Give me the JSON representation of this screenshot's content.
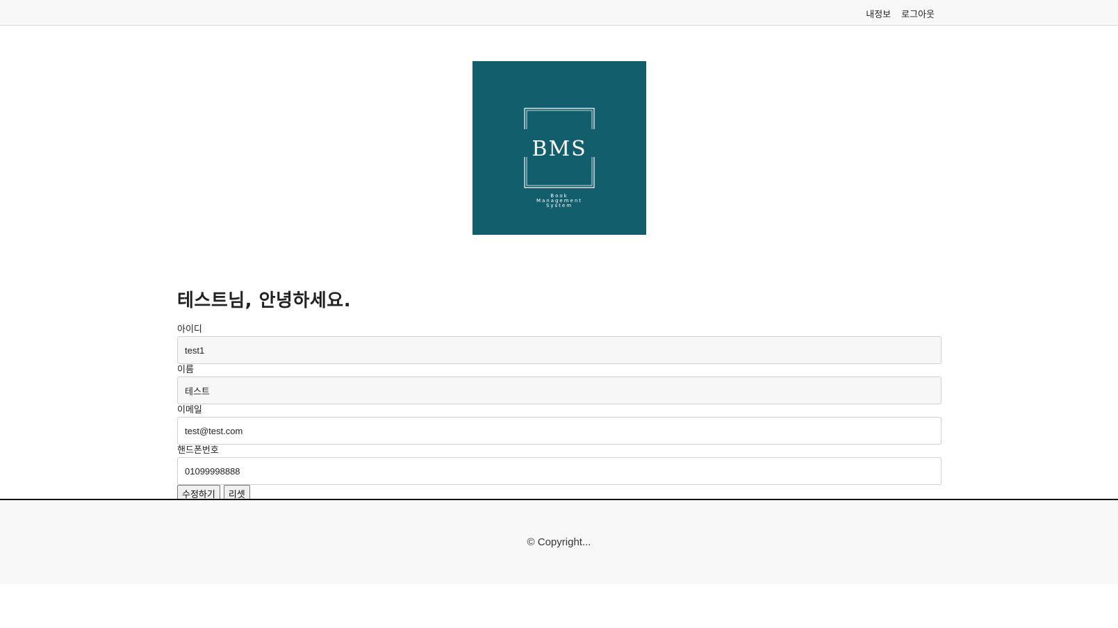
{
  "header": {
    "nav": {
      "my_info": "내정보",
      "logout": "로그아웃"
    }
  },
  "logo": {
    "title": "BMS",
    "subtitle_lines": [
      "Book",
      "Management",
      "System"
    ],
    "background_color": "#135e6d",
    "line_color": "#ffffff"
  },
  "greeting": "테스트님, 안녕하세요.",
  "form": {
    "fields": [
      {
        "label": "아이디",
        "value": "test1",
        "readonly": true
      },
      {
        "label": "이름",
        "value": "테스트",
        "readonly": true
      },
      {
        "label": "이메일",
        "value": "test@test.com",
        "readonly": false
      },
      {
        "label": "핸드폰번호",
        "value": "01099998888",
        "readonly": false
      }
    ],
    "submit_label": "수정하기",
    "reset_label": "리셋"
  },
  "footer": {
    "copyright": "© Copyright..."
  }
}
